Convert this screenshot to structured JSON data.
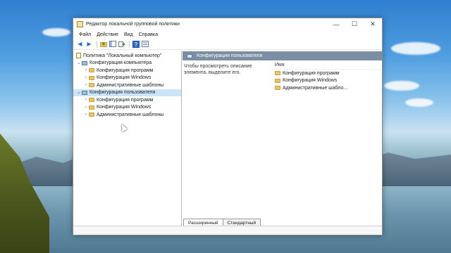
{
  "window": {
    "title": "Редактор локальной групповой политики",
    "controls": {
      "minimize": "—",
      "maximize": "☐",
      "close": "✕"
    }
  },
  "menu": [
    "Файл",
    "Действие",
    "Вид",
    "Справка"
  ],
  "toolbar": {
    "icons": [
      "back-icon",
      "forward-icon",
      "up-folder-icon",
      "show-hide-tree-icon",
      "export-icon",
      "help-icon",
      "properties-icon"
    ],
    "back": "◀",
    "forward": "▶"
  },
  "tree": {
    "root": "Политика \"Локальный компьютер\"",
    "computer": {
      "label": "Конфигурация компьютера",
      "children": [
        "Конфигурация программ",
        "Конфигурация Windows",
        "Административные шаблоны"
      ]
    },
    "user": {
      "label": "Конфигурация пользователя",
      "children": [
        "Конфигурация программ",
        "Конфигурация Windows",
        "Административные шаблоны"
      ]
    },
    "expander_collapsed": "›",
    "expander_expanded": "⌄"
  },
  "details": {
    "header": "Конфигурация пользователя",
    "description": "Чтобы просмотреть описание элемента, выделите его.",
    "column_name": "Имя",
    "items": [
      "Конфигурация программ",
      "Конфигурация Windows",
      "Административные шабло..."
    ]
  },
  "tabs": {
    "extended": "Расширенный",
    "standard": "Стандартный"
  }
}
